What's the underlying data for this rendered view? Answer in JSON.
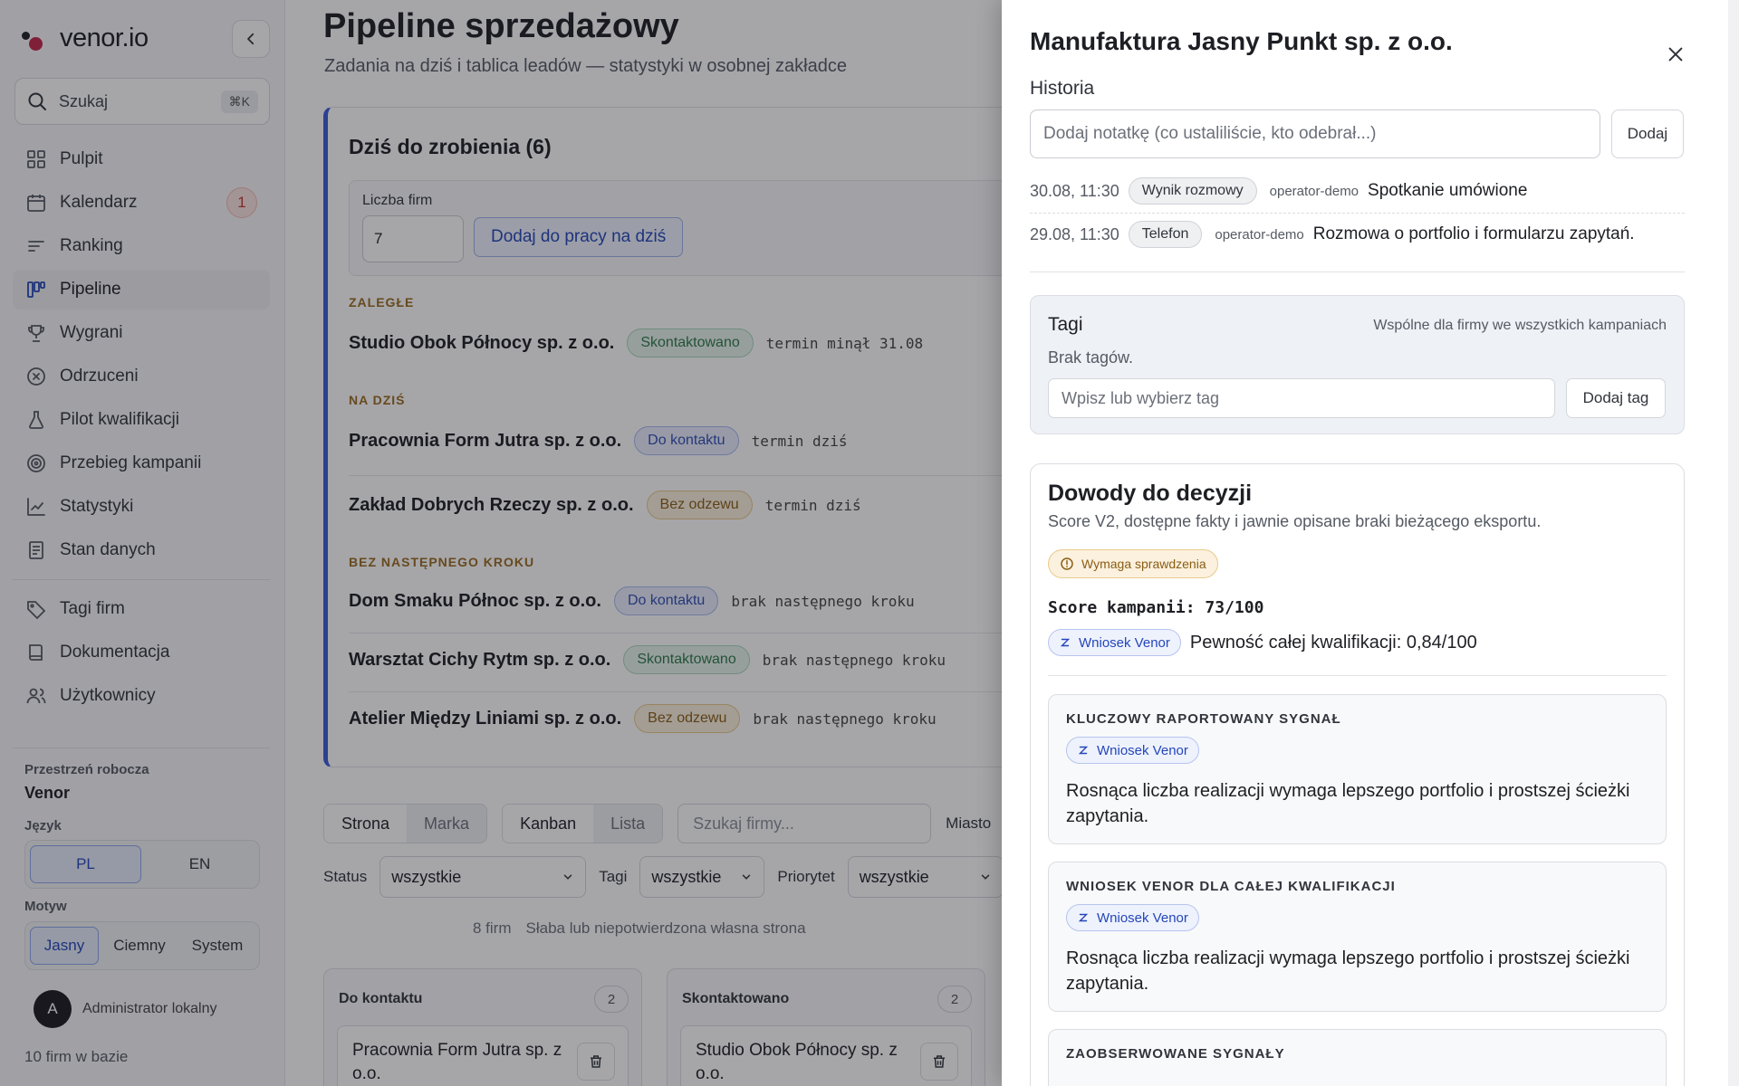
{
  "sidebar": {
    "brand": "venor.io",
    "search": {
      "placeholder": "Szukaj",
      "shortcut": "⌘K"
    },
    "nav": [
      {
        "label": "Pulpit",
        "icon": "grid-icon"
      },
      {
        "label": "Kalendarz",
        "icon": "calendar-icon",
        "badge": "1"
      },
      {
        "label": "Ranking",
        "icon": "bars-icon"
      },
      {
        "label": "Pipeline",
        "icon": "kanban-icon",
        "active": true
      },
      {
        "label": "Wygrani",
        "icon": "trophy-icon"
      },
      {
        "label": "Odrzuceni",
        "icon": "x-circle-icon"
      },
      {
        "label": "Pilot kwalifikacji",
        "icon": "flask-icon"
      },
      {
        "label": "Przebieg kampanii",
        "icon": "target-icon"
      },
      {
        "label": "Statystyki",
        "icon": "chart-icon"
      },
      {
        "label": "Stan danych",
        "icon": "document-icon"
      }
    ],
    "nav2": [
      {
        "label": "Tagi firm",
        "icon": "tag-icon"
      },
      {
        "label": "Dokumentacja",
        "icon": "book-icon"
      },
      {
        "label": "Użytkownicy",
        "icon": "users-icon"
      }
    ],
    "workspace_label": "Przestrzeń robocza",
    "workspace_value": "Venor",
    "language_label": "Język",
    "language_options": [
      "PL",
      "EN"
    ],
    "language_selected": "PL",
    "theme_label": "Motyw",
    "theme_options": [
      "Jasny",
      "Ciemny",
      "System"
    ],
    "theme_selected": "Jasny",
    "user_initial": "A",
    "user_name": "Administrator lokalny",
    "firms_count": "10 firm w bazie"
  },
  "main": {
    "title": "Pipeline sprzedażowy",
    "subtitle": "Zadania na dziś i tablica leadów — statystyki w osobnej zakładce",
    "today": {
      "title": "Dziś do zrobienia (6)",
      "count_label": "Liczba firm",
      "count_value": "7",
      "add_button": "Dodaj do pracy na dziś",
      "overdue_label": "ZALEGŁE",
      "today_label": "NA DZIŚ",
      "no_step_label": "BEZ NASTĘPNEGO KROKU",
      "leads": [
        {
          "name": "Studio Obok Północy sp. z o.o.",
          "status": "Skontaktowano",
          "note": "termin minął 31.08"
        },
        {
          "name": "Pracownia Form Jutra sp. z o.o.",
          "status": "Do kontaktu",
          "note": "termin dziś"
        },
        {
          "name": "Zakład Dobrych Rzeczy sp. z o.o.",
          "status": "Bez odzewu",
          "note": "termin dziś"
        },
        {
          "name": "Dom Smaku Północ sp. z o.o.",
          "status": "Do kontaktu",
          "note": "brak następnego kroku"
        },
        {
          "name": "Warsztat Cichy Rytm sp. z o.o.",
          "status": "Skontaktowano",
          "note": "brak następnego kroku"
        },
        {
          "name": "Atelier Między Liniami sp. z o.o.",
          "status": "Bez odzewu",
          "note": "brak następnego kroku"
        }
      ]
    },
    "toolbar": {
      "mode_options": [
        "Strona",
        "Marka"
      ],
      "mode_selected": "Strona",
      "view_options": [
        "Kanban",
        "Lista"
      ],
      "view_selected": "Kanban",
      "search_placeholder": "Szukaj firmy...",
      "city_label": "Miasto",
      "status_label": "Status",
      "status_value": "wszystkie",
      "tags_label": "Tagi",
      "tags_value": "wszystkie",
      "priority_label": "Priorytet",
      "priority_value": "wszystkie"
    },
    "summary": {
      "count": "8 firm",
      "filter": "Słaba lub niepotwierdzona własna strona"
    },
    "columns": [
      {
        "title": "Do kontaktu",
        "count": "2",
        "first_card": "Pracownia Form Jutra sp. z o.o."
      },
      {
        "title": "Skontaktowano",
        "count": "2",
        "first_card": "Studio Obok Północy sp. z o.o."
      }
    ]
  },
  "drawer": {
    "title": "Manufaktura Jasny Punkt sp. z o.o.",
    "history_label": "Historia",
    "note_placeholder": "Dodaj notatkę (co ustaliliście, kto odebrał...)",
    "note_button": "Dodaj",
    "history": [
      {
        "time": "30.08, 11:30",
        "type": "Wynik rozmowy",
        "operator": "operator-demo",
        "text": "Spotkanie umówione"
      },
      {
        "time": "29.08, 11:30",
        "type": "Telefon",
        "operator": "operator-demo",
        "text": "Rozmowa o portfolio i formularzu zapytań."
      }
    ],
    "tags": {
      "title": "Tagi",
      "scope": "Wspólne dla firmy we wszystkich kampaniach",
      "empty": "Brak tagów.",
      "input_placeholder": "Wpisz lub wybierz tag",
      "add_button": "Dodaj tag"
    },
    "evidence": {
      "title": "Dowody do decyzji",
      "subtitle": "Score V2, dostępne fakty i jawnie opisane braki bieżącego eksportu.",
      "warning": "Wymaga sprawdzenia",
      "score": "Score kampanii: 73/100",
      "venor_badge": "Wniosek Venor",
      "confidence": "Pewność całej kwalifikacji: 0,84/100",
      "signals": [
        {
          "label": "KLUCZOWY RAPORTOWANY SYGNAŁ",
          "badge": "Wniosek Venor",
          "text": "Rosnąca liczba realizacji wymaga lepszego portfolio i prostszej ścieżki zapytania."
        },
        {
          "label": "WNIOSEK VENOR DLA CAŁEJ KWALIFIKACJI",
          "badge": "Wniosek Venor",
          "text": "Rosnąca liczba realizacji wymaga lepszego portfolio i prostszej ścieżki zapytania."
        },
        {
          "label": "ZAOBSERWOWANE SYGNAŁY"
        }
      ]
    }
  },
  "colors": {
    "accent": "#3a5bd9",
    "brand_dot": "#c2284a",
    "overdue": "#9a6b1f",
    "badge_red": "#c0392b"
  }
}
